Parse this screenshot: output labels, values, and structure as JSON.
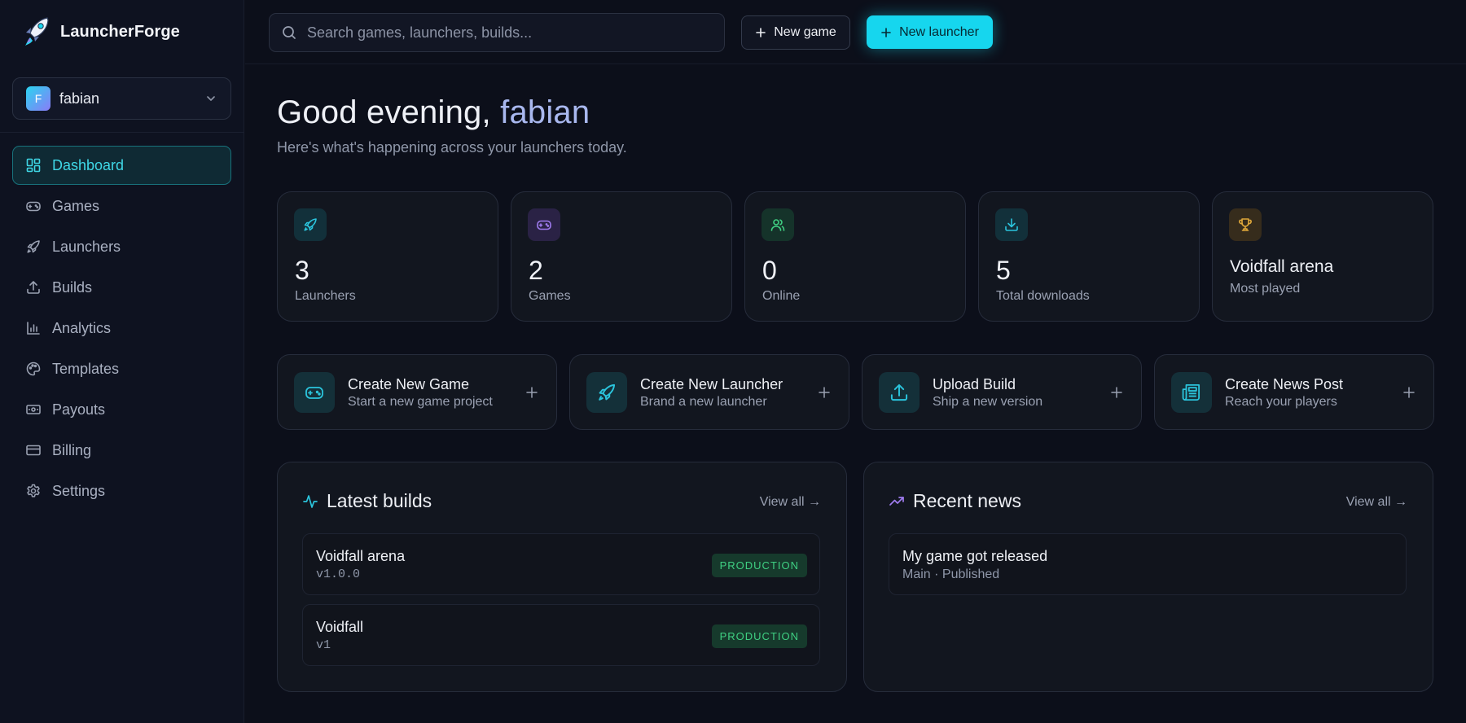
{
  "app": {
    "name": "LauncherForge"
  },
  "user": {
    "initial": "F",
    "name": "fabian"
  },
  "sidebar": {
    "items": [
      {
        "label": "Dashboard",
        "icon": "dashboard-icon",
        "active": true
      },
      {
        "label": "Games",
        "icon": "gamepad-icon"
      },
      {
        "label": "Launchers",
        "icon": "rocket-icon"
      },
      {
        "label": "Builds",
        "icon": "upload-icon"
      },
      {
        "label": "Analytics",
        "icon": "bar-chart-icon"
      },
      {
        "label": "Templates",
        "icon": "palette-icon"
      },
      {
        "label": "Payouts",
        "icon": "banknote-icon"
      },
      {
        "label": "Billing",
        "icon": "credit-card-icon"
      },
      {
        "label": "Settings",
        "icon": "gear-icon"
      }
    ]
  },
  "topbar": {
    "search_placeholder": "Search games, launchers, builds...",
    "new_game_label": "New game",
    "new_launcher_label": "New launcher"
  },
  "header": {
    "greeting": "Good evening,",
    "username": "fabian",
    "subtitle": "Here's what's happening across your launchers today."
  },
  "stats": [
    {
      "value": "3",
      "label": "Launchers",
      "icon": "rocket-icon",
      "color": "#2bc4dc"
    },
    {
      "value": "2",
      "label": "Games",
      "icon": "gamepad-icon",
      "color": "#a07cf0"
    },
    {
      "value": "0",
      "label": "Online",
      "icon": "users-icon",
      "color": "#3fcf82"
    },
    {
      "value": "5",
      "label": "Total downloads",
      "icon": "download-icon",
      "color": "#2bc4dc"
    },
    {
      "value": "Voidfall arena",
      "label": "Most played",
      "icon": "trophy-icon",
      "color": "#e0a83a"
    }
  ],
  "actions": [
    {
      "title": "Create New Game",
      "subtitle": "Start a new game project",
      "icon": "gamepad-icon"
    },
    {
      "title": "Create New Launcher",
      "subtitle": "Brand a new launcher",
      "icon": "rocket-icon"
    },
    {
      "title": "Upload Build",
      "subtitle": "Ship a new version",
      "icon": "upload-icon"
    },
    {
      "title": "Create News Post",
      "subtitle": "Reach your players",
      "icon": "newspaper-icon"
    }
  ],
  "builds": {
    "title": "Latest builds",
    "view_all": "View all →",
    "items": [
      {
        "name": "Voidfall arena",
        "version": "v1.0.0",
        "channel": "PRODUCTION"
      },
      {
        "name": "Voidfall",
        "version": "v1",
        "channel": "PRODUCTION"
      }
    ]
  },
  "news": {
    "title": "Recent news",
    "view_all": "View all →",
    "items": [
      {
        "title": "My game got released",
        "meta": "Main · Published"
      }
    ]
  },
  "colors": {
    "accent": "#16d6ee",
    "background": "#0c0f1a",
    "success": "#3fcf82"
  }
}
